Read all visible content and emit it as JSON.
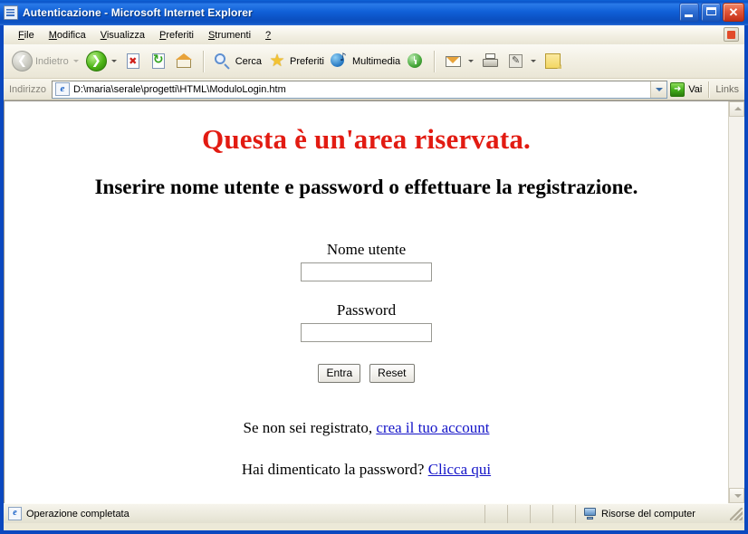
{
  "window": {
    "title": "Autenticazione - Microsoft Internet Explorer",
    "icon": "ie-document-icon",
    "controls": {
      "minimize": "Riduci a icona",
      "maximize": "Ingrandisci",
      "close": "Chiudi",
      "close_glyph": "✕"
    },
    "titlebar_color": "#0a54c8",
    "frame_color": "#0b48bf"
  },
  "menubar": {
    "items": [
      {
        "label": "File",
        "accel": "F"
      },
      {
        "label": "Modifica",
        "accel": "M"
      },
      {
        "label": "Visualizza",
        "accel": "V"
      },
      {
        "label": "Preferiti",
        "accel": "P"
      },
      {
        "label": "Strumenti",
        "accel": "S"
      },
      {
        "label": "?",
        "accel": "?"
      }
    ]
  },
  "toolbar": {
    "back": {
      "label": "Indietro",
      "icon": "back-arrow-icon",
      "enabled": false
    },
    "forward": {
      "label": "",
      "icon": "forward-arrow-icon",
      "enabled": true
    },
    "stop": {
      "label": "",
      "icon": "stop-icon"
    },
    "refresh": {
      "label": "",
      "icon": "refresh-icon"
    },
    "home": {
      "label": "",
      "icon": "home-icon"
    },
    "search": {
      "label": "Cerca",
      "icon": "search-icon"
    },
    "favorites": {
      "label": "Preferiti",
      "icon": "star-icon"
    },
    "multimedia": {
      "label": "Multimedia",
      "icon": "multimedia-icon"
    },
    "history": {
      "label": "",
      "icon": "history-icon"
    },
    "mail": {
      "label": "",
      "icon": "mail-icon"
    },
    "print": {
      "label": "",
      "icon": "print-icon"
    },
    "edit": {
      "label": "",
      "icon": "edit-icon"
    },
    "notes": {
      "label": "",
      "icon": "notes-icon"
    }
  },
  "addressbar": {
    "label": "Indirizzo",
    "value": "D:\\maria\\serale\\progetti\\HTML\\ModuloLogin.htm",
    "placeholder": "",
    "go_label": "Vai",
    "links_label": "Links"
  },
  "page": {
    "heading": "Questa è un'area riservata.",
    "heading_color": "#e21b12",
    "subheading": "Inserire nome utente e password o effettuare la registrazione.",
    "subheading_color": "#000000",
    "form": {
      "username": {
        "label": "Nome utente",
        "value": "",
        "placeholder": ""
      },
      "password": {
        "label": "Password",
        "value": "",
        "placeholder": ""
      },
      "submit_label": "Entra",
      "reset_label": "Reset"
    },
    "register": {
      "text": "Se non sei registrato,",
      "link": "crea il tuo account"
    },
    "forgot": {
      "text": "Hai dimenticato la password?",
      "link": "Clicca qui"
    },
    "link_color": "#1414c8"
  },
  "statusbar": {
    "message": "Operazione completata",
    "zone": "Risorse del computer",
    "zone_icon": "computer-icon"
  }
}
